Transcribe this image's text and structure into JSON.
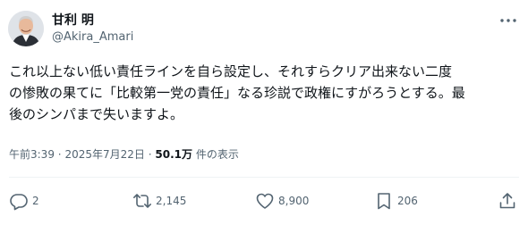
{
  "author": {
    "display_name": "甘利 明",
    "handle": "@Akira_Amari",
    "avatar_icon": "avatar"
  },
  "post": {
    "lines": [
      "これ以上ない低い責任ラインを自ら設定し、それすらクリア出来ない二度",
      "の惨敗の果てに「比較第一党の責任」なる珍説で政権にすがろうとする。最",
      "後のシンパまで失いますよ。"
    ]
  },
  "meta": {
    "time": "午前3:39",
    "separator": "·",
    "date": "2025年7月22日",
    "views_count": "50.1万",
    "views_label": "件の表示"
  },
  "actions": {
    "reply_count": "2",
    "retweet_count": "2,145",
    "like_count": "8,900",
    "bookmark_count": "206"
  },
  "colors": {
    "text_primary": "#0f1419",
    "text_secondary": "#536471",
    "divider": "#eff3f4"
  }
}
